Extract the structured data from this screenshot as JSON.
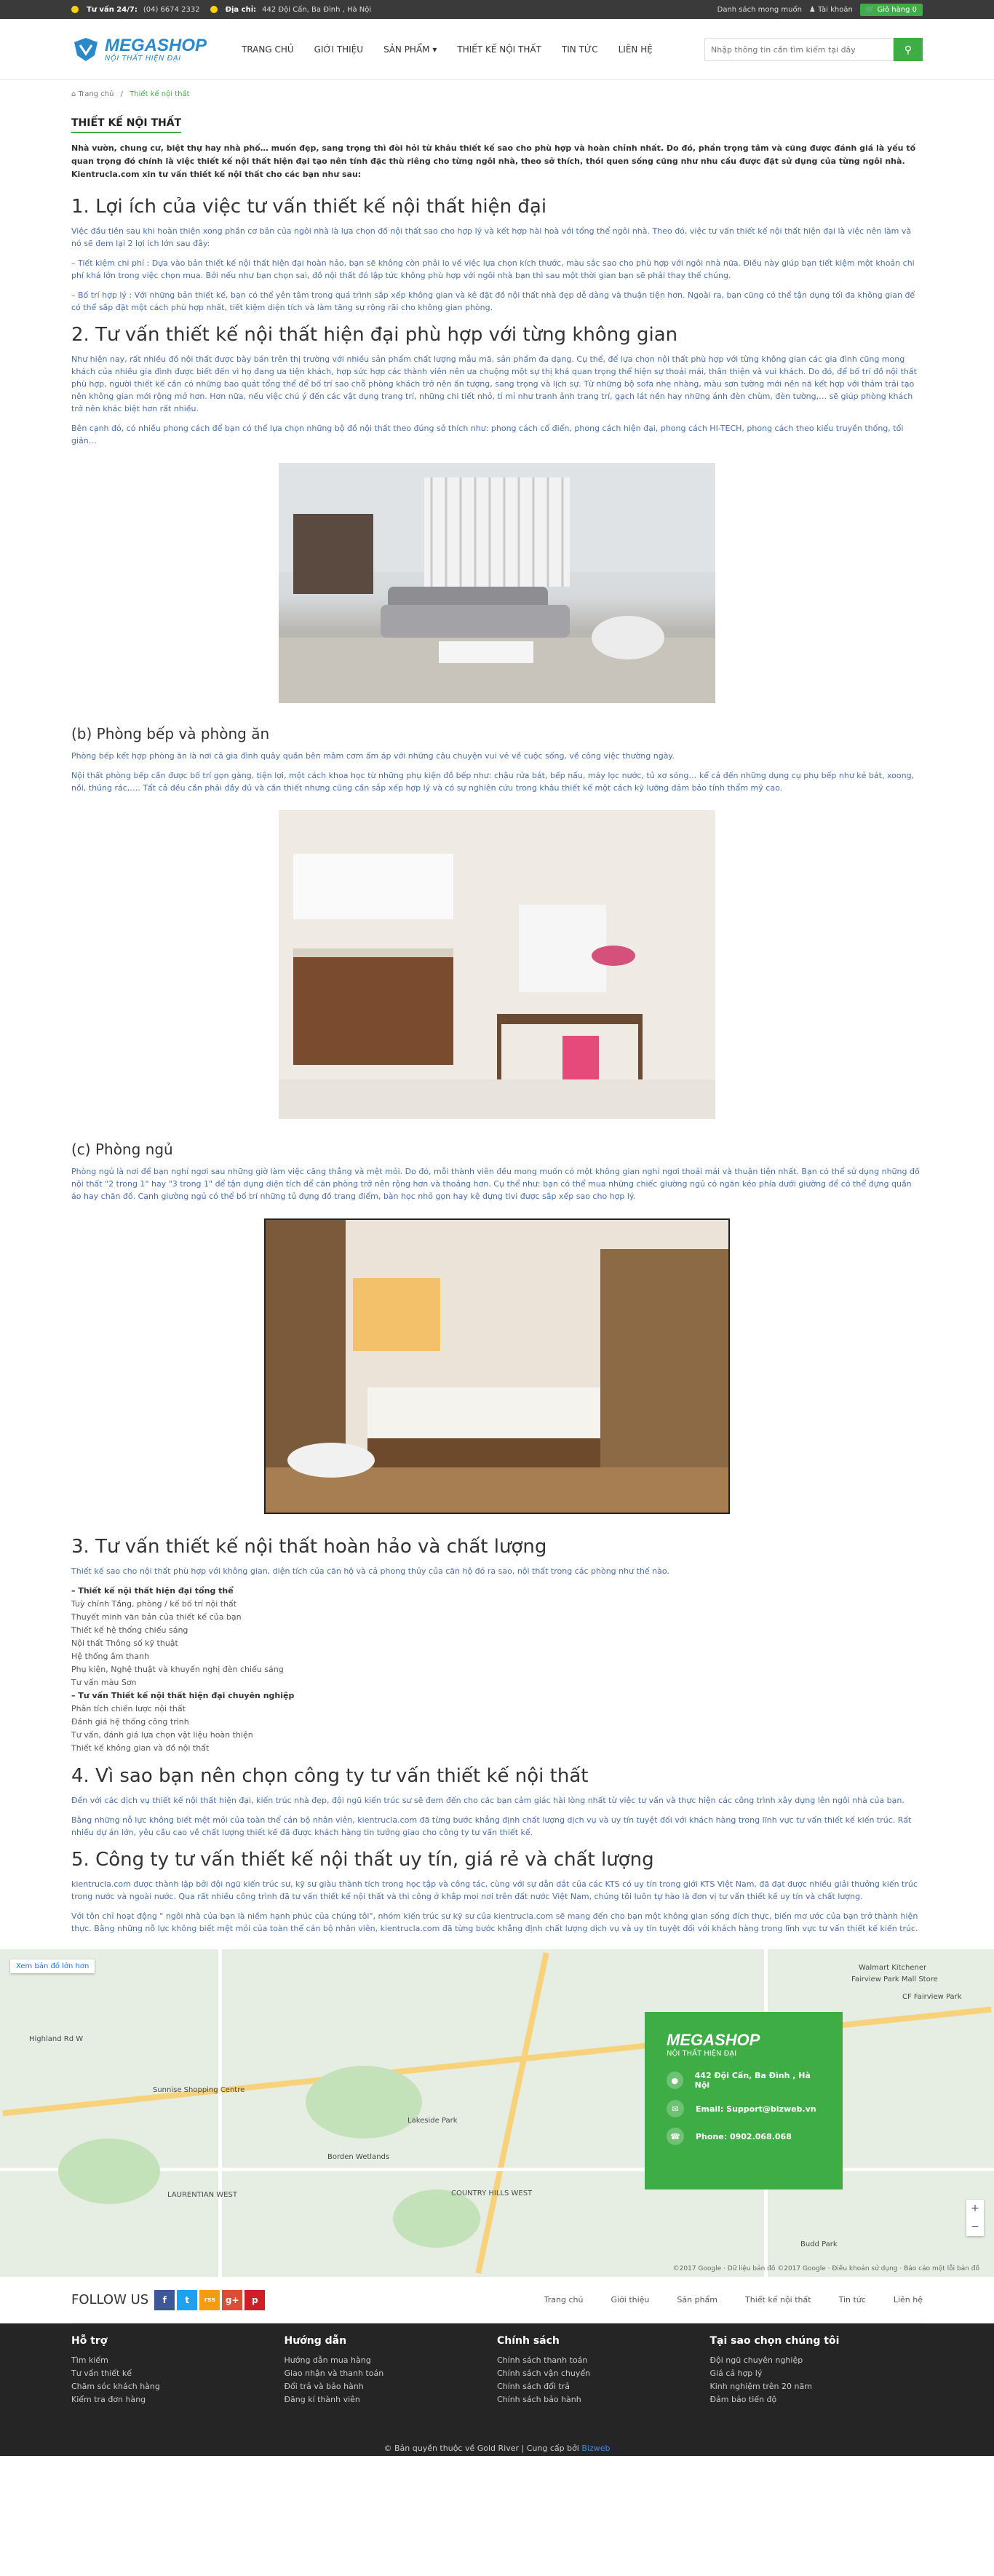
{
  "topbar": {
    "hotline_label": "Tư vấn 24/7:",
    "hotline": "(04) 6674 2332",
    "address_label": "Địa chỉ:",
    "address": "442 Đội Cấn, Ba Đình , Hà Nội",
    "wishlist": "Danh sách mong muốn",
    "account": "Tài khoản",
    "cart": "Giỏ hàng 0"
  },
  "logo": {
    "name": "MEGASHOP",
    "tagline": "NỘI THẤT HIỆN ĐẠI"
  },
  "nav": [
    "TRANG CHỦ",
    "GIỚI THIỆU",
    "SẢN PHẨM ▾",
    "THIẾT KẾ NỘI THẤT",
    "TIN TỨC",
    "LIÊN HỆ"
  ],
  "search": {
    "placeholder": "Nhập thông tin cần tìm kiếm tại đây"
  },
  "breadcrumb": {
    "home": "Trang chủ",
    "sep": "/",
    "current": "Thiết kế nội thất"
  },
  "page": {
    "title": "THIẾT KẾ NỘI THẤT",
    "intro": "Nhà vườn, chung cư, biệt thự hay nhà phố… muốn đẹp, sang trọng thì đòi hỏi từ khâu thiết kế sao cho phù hợp và hoàn chỉnh nhất. Do đó, phần trọng tâm và cũng được đánh giá là yếu tố quan trọng đó chính là việc thiết kế nội thất hiện đại tạo nên tính đặc thù riêng cho từng ngôi nhà, theo sở thích, thói quen sống cũng như nhu cầu được đặt sử dụng của từng ngôi nhà. Kientrucla.com xin tư vấn thiết kế nội thất cho các bạn như sau:",
    "s1_title": "1. Lợi ích của việc tư vấn thiết kế nội thất hiện đại",
    "s1_p1": "Việc đầu tiên sau khi hoàn thiện xong phần cơ bản của ngôi nhà là lựa chọn đồ nội thất sao cho hợp lý và kết hợp hài hoà với tổng thể ngôi nhà. Theo đó, việc tư vấn thiết kế nội thất hiện đại là việc nên làm và nó sẽ đem lại 2 lợi ích lớn sau đây:",
    "s1_p2": "– Tiết kiệm chi phí : Dựa vào bản thiết kế nội thất hiện đại hoàn hảo, bạn sẽ không còn phải lo về việc lựa chọn kích thước, màu sắc sao cho phù hợp với ngôi nhà nữa. Điều này giúp bạn tiết kiệm một khoản chi phí khá lớn trong việc chọn mua. Bởi nếu như bạn chọn sai, đồ nội thất đó lập tức không phù hợp với ngôi nhà bạn thì sau một thời gian bạn sẽ phải thay thế chúng.",
    "s1_p3": "– Bố trí hợp lý : Với những bản thiết kế, bạn có thể yên tâm trong quá trình sắp xếp không gian và kê đặt đồ nội thất nhà đẹp dễ dàng và thuận tiện hơn. Ngoài ra, bạn cũng có thể tận dụng tối đa không gian để có thể sắp đặt một cách phù hợp nhất, tiết kiệm diện tích và làm tăng sự rộng rãi cho không gian phòng.",
    "s2_title": "2. Tư vấn thiết kế nội thất hiện đại phù hợp với từng không gian",
    "s2_p1": "Như hiện nay, rất nhiều đồ nội thất được bày bán trên thị trường với nhiều sản phẩm chất lượng mẫu mã, sản phẩm đa dạng. Cụ thể, để lựa chọn nội thất phù hợp với từng không gian các gia đình cũng mong khách của nhiều gia đình được biết đến vì họ đang ưa tiện khách, hợp sức hợp các thành viên nên ưa chuộng một sự thị khá quan trọng thể hiện sự thoải mái, thân thiện và vui khách. Do đó, để bố trí đồ nội thất phù hợp, người thiết kế cần có những bao quát tổng thể để bố trí sao chỗ phòng khách trở nên ấn tượng, sang trọng và lịch sự. Từ những bộ sofa nhẹ nhàng, màu sơn tường mới nền nã kết hợp với thảm trải tạo nên không gian mới rộng mở hơn. Hơn nữa, nếu việc chú ý đến các vật dụng trang trí, những chi tiết nhỏ, tỉ mỉ như tranh ảnh trang trí, gạch lát nền hay những ánh đèn chùm, đèn tường,… sẽ giúp phòng khách trở nên khác biệt hơn rất nhiều.",
    "s2_p2": "Bên cạnh đó, có nhiều phong cách để bạn có thể lựa chọn những bộ đồ nội thất theo đúng sở thích như: phong cách cổ điển, phong cách hiện đại, phong cách HI-TECH, phong cách theo kiểu truyền thống, tối giản…",
    "s2b_title": "(b) Phòng bếp và phòng ăn",
    "s2b_p1": "Phòng bếp kết hợp phòng ăn là nơi cả gia đình quây quần bên mâm cơm ấm áp với những câu chuyện vui vẻ về cuộc sống, về công việc thường ngày.",
    "s2b_p2": "Nội thất phòng bếp cần được bố trí gọn gàng, tiện lợi, một cách khoa học từ những phụ kiện đồ bếp như: chậu rửa bát, bếp nấu, máy lọc nước, tủ xơ sóng… kể cả đến những dụng cụ phụ bếp như kẻ bát, xoong, nồi, thúng rác,…. Tất cả đều cần phải đầy đủ và cần thiết nhưng cũng cần sắp xếp hợp lý và có sự nghiên cứu trong khâu thiết kế một cách kỹ lưỡng đảm bảo tính thẩm mỹ cao.",
    "s2c_title": "(c) Phòng ngủ",
    "s2c_p1": "Phòng ngủ là nơi để bạn nghỉ ngơi sau những giờ làm việc căng thẳng và mệt mỏi. Do đó, mỗi thành viên đều mong muốn có một không gian nghỉ ngơi thoải mái và thuận tiện nhất. Bạn có thể sử dụng những đồ nội thất \"2 trong 1\" hay \"3 trong 1\" để tận dụng diện tích để căn phòng trở nên rộng hơn và thoáng hơn. Cụ thể như: bạn có thể mua những chiếc giường ngủ có ngăn kéo phía dưới giường để có thể đựng quần áo hay chăn đồ. Cạnh giường ngủ có thể bố trí những tủ đựng đồ trang điểm, bàn học nhỏ gọn hay kệ đựng tivi được sắp xếp sao cho hợp lý.",
    "s3_title": "3. Tư vấn thiết kế nội thất hoàn hảo và chất lượng",
    "s3_p1": "Thiết kế sao cho nội thất phù hợp với không gian, diện tích của căn hộ và cả phong thủy của căn hộ đó ra sao, nội thất trong các phòng như thế nào.",
    "s3_list": [
      {
        "t": "– Thiết kế nội thất hiện đại tổng thể",
        "b": true
      },
      {
        "t": "Tuỳ chỉnh Tầng, phòng / kế bố trí nội thất",
        "b": false
      },
      {
        "t": "Thuyết minh văn bản của thiết kế của bạn",
        "b": false
      },
      {
        "t": "Thiết kế hệ thống chiếu sáng",
        "b": false
      },
      {
        "t": "Nội thất Thông số kỹ thuật",
        "b": false
      },
      {
        "t": "Hệ thống âm thanh",
        "b": false
      },
      {
        "t": "Phụ kiện, Nghệ thuật và khuyến nghị đèn chiếu sáng",
        "b": false
      },
      {
        "t": "Tư vấn màu Sơn",
        "b": false
      },
      {
        "t": "– Tư vấn Thiết kế nội thất hiện đại chuyên nghiệp",
        "b": true
      },
      {
        "t": "Phân tích chiến lược nội thất",
        "b": false
      },
      {
        "t": "Đánh giá hệ thống công trình",
        "b": false
      },
      {
        "t": "Tư vấn, đánh giá lựa chọn vật liệu hoàn thiện",
        "b": false
      },
      {
        "t": " Thiết kế không gian và đồ nội thất",
        "b": false
      }
    ],
    "s4_title": "4. Vì sao bạn nên chọn công ty tư vấn thiết kế nội thất",
    "s4_p1": "Đến với các dịch vụ thiết kế nội thất hiện đại, kiến trúc nhà đẹp, đội ngũ kiến trúc sư sẽ đem đến cho các bạn cảm giác hài lòng nhất từ việc tư vấn và thực hiện các công trình xây dựng lên ngôi nhà của bạn.",
    "s4_p2": "Bằng những nỗ lực không biết mệt mỏi của toàn thể cán bộ nhân viên, kientrucla.com đã từng bước khẳng định chất lượng dịch vụ và uy tín tuyệt đối với khách hàng trong lĩnh vực tư vấn thiết kế kiến trúc. Rất nhiều dự án lớn, yêu cầu cao về chất lượng thiết kế đã được khách hàng tin tưởng giao cho công ty tư vấn thiết kế.",
    "s5_title": "5. Công ty tư vấn thiết kế nội thất uy tín, giá rẻ và chất lượng",
    "s5_p1": "kientrucla.com được thành lập bởi đội ngũ kiến trúc sư, kỹ sư giàu thành tích trong học tập và công tác, cùng với sự dẫn dắt của các KTS có uy tín trong giới KTS Việt Nam, đã đạt được nhiều giải thưởng kiến trúc trong nước và ngoài nước. Qua rất nhiều công trình đã tư vấn thiết kế nội thất và thi công ở khắp mọi nơi trên đất nước Việt Nam, chúng tôi luôn tự hào là đơn vị tư vấn thiết kế uy tín và chất lượng.",
    "s5_p2": "Với tôn chỉ hoạt động \" ngôi nhà của bạn là niềm hạnh phúc của chúng tôi\", nhóm kiến trúc sư kỹ sư của kientrucla.com sẽ mang đến cho bạn một không gian sống đích thực, biến mơ ước của bạn trở thành hiện thực. Bằng những nỗ lực không biết mệt mỏi của toàn thể cán bộ nhân viên, kientrucla.com đã từng bước khẳng định chất lượng dịch vụ và uy tín tuyệt đối với khách hàng trong lĩnh vực tư vấn thiết kế kiến trúc."
  },
  "map": {
    "expand": "Xem bản đồ lớn hơn",
    "labels": [
      "Sunnise Shopping Centre",
      "LAURENTIAN WEST",
      "COUNTRY HILLS WEST",
      "Walmart Kitchener",
      "Fairview Park Mall Store",
      "CF Fairview Park",
      "Budd Park",
      "Borden Wetlands",
      "Lakeside Park",
      "Highland Rd W"
    ],
    "card": {
      "name": "MEGASHOP",
      "tagline": "NỘI THẤT HIỆN ĐẠI",
      "address": "442 Đội Cấn, Ba Đình , Hà Nội",
      "email": "Email: Support@bizweb.vn",
      "phone": "Phone: 0902.068.068"
    },
    "attribution": "©2017 Google · Dữ liệu bản đồ ©2017 Google · Điều khoản sử dụng · Báo cáo một lỗi bản đồ"
  },
  "follow": {
    "label": "FOLLOW US",
    "social": [
      "f",
      "t",
      "rss",
      "g+",
      "p"
    ],
    "links": [
      "Trang chủ",
      "Giới thiệu",
      "Sản phẩm",
      "Thiết kế nội thất",
      "Tin tức",
      "Liên hệ"
    ]
  },
  "footer": {
    "cols": [
      {
        "title": "Hỗ trợ",
        "items": [
          "Tìm kiếm",
          "Tư vấn thiết kế",
          "Chăm sóc khách hàng",
          "Kiểm tra đơn hàng"
        ]
      },
      {
        "title": "Hướng dẫn",
        "items": [
          "Hướng dẫn mua hàng",
          "Giao nhận và thanh toán",
          "Đổi trả và bảo hành",
          "Đăng kí thành viên"
        ]
      },
      {
        "title": "Chính sách",
        "items": [
          "Chính sách thanh toán",
          "Chính sách vận chuyển",
          "Chính sách đổi trả",
          "Chính sách bảo hành"
        ]
      },
      {
        "title": "Tại sao chọn chúng tôi",
        "items": [
          "Đội ngũ chuyên nghiệp",
          "Giá cả hợp lý",
          "Kinh nghiệm trên 20 năm",
          "Đảm bảo tiến độ"
        ]
      }
    ],
    "copyright": "© Bản quyền thuộc về Gold River | Cung cấp bởi",
    "provider": "Bizweb"
  },
  "colors": {
    "accent": "#3fad46",
    "brand": "#2c89c9",
    "dark": "#252525"
  }
}
